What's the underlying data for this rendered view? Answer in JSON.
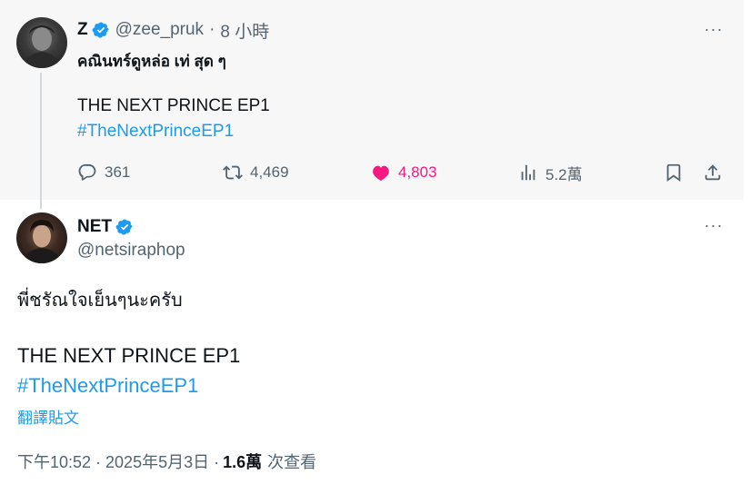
{
  "parent_tweet": {
    "display_name": "Z",
    "handle": "@zee_pruk",
    "separator": "·",
    "time": "8 小時",
    "text_thai": "คณินทร์ดูหล่อ เท่ สุด ๆ",
    "text_line": "THE NEXT PRINCE EP1",
    "hashtag": "#TheNextPrinceEP1",
    "actions": {
      "replies": "361",
      "retweets": "4,469",
      "likes": "4,803",
      "views": "5.2萬"
    },
    "more": "···"
  },
  "reply_tweet": {
    "display_name": "NET",
    "handle": "@netsiraphop",
    "text_thai": "พี่ชรัณใจเย็นๆนะครับ",
    "text_line": "THE NEXT PRINCE EP1",
    "hashtag": "#TheNextPrinceEP1",
    "translate": "翻譯貼文",
    "timestamp": "下午10:52 · 2025年5月3日 ·",
    "views_count": "1.6萬",
    "views_label": "次查看",
    "more": "···"
  },
  "colors": {
    "accent": "#1d9bf0",
    "like": "#f91880",
    "muted": "#536471",
    "text": "#0f1419",
    "verified": "#1d9bf0"
  },
  "icons": [
    "reply-icon",
    "retweet-icon",
    "heart-icon",
    "views-icon",
    "bookmark-icon",
    "share-icon",
    "verified-badge-icon",
    "more-icon"
  ]
}
